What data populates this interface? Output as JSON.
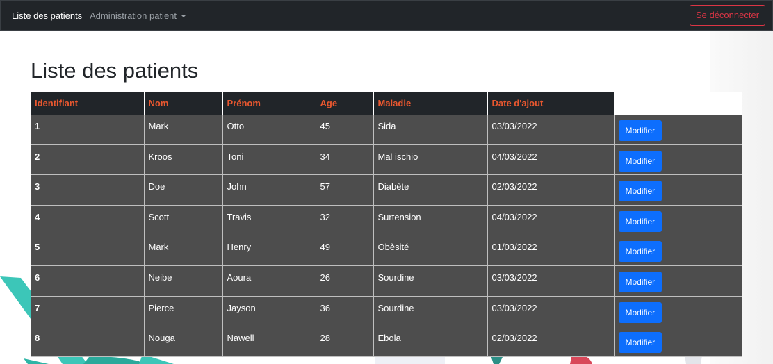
{
  "nav": {
    "brand": "Liste des patients",
    "admin_menu": "Administration patient",
    "logout": "Se déconnecter"
  },
  "page": {
    "title": "Liste des patients"
  },
  "table": {
    "headers": [
      "Identifiant",
      "Nom",
      "Prénom",
      "Age",
      "Maladie",
      "Date d'ajout"
    ],
    "rows": [
      {
        "id": "1",
        "nom": "Mark",
        "prenom": "Otto",
        "age": "45",
        "maladie": "Sida",
        "date": "03/03/2022",
        "action": "Modifier"
      },
      {
        "id": "2",
        "nom": "Kroos",
        "prenom": "Toni",
        "age": "34",
        "maladie": "Mal ischio",
        "date": "04/03/2022",
        "action": "Modifier"
      },
      {
        "id": "3",
        "nom": "Doe",
        "prenom": "John",
        "age": "57",
        "maladie": "Diabète",
        "date": "02/03/2022",
        "action": "Modifier"
      },
      {
        "id": "4",
        "nom": "Scott",
        "prenom": "Travis",
        "age": "32",
        "maladie": "Surtension",
        "date": "04/03/2022",
        "action": "Modifier"
      },
      {
        "id": "5",
        "nom": "Mark",
        "prenom": "Henry",
        "age": "49",
        "maladie": "Obèsité",
        "date": "01/03/2022",
        "action": "Modifier"
      },
      {
        "id": "6",
        "nom": "Neibe",
        "prenom": "Aoura",
        "age": "26",
        "maladie": "Sourdine",
        "date": "03/03/2022",
        "action": "Modifier"
      },
      {
        "id": "7",
        "nom": "Pierce",
        "prenom": "Jayson",
        "age": "36",
        "maladie": "Sourdine",
        "date": "03/03/2022",
        "action": "Modifier"
      },
      {
        "id": "8",
        "nom": "Nouga",
        "prenom": "Nawell",
        "age": "28",
        "maladie": "Ebola",
        "date": "02/03/2022",
        "action": "Modifier"
      }
    ]
  },
  "colors": {
    "navbar": "#212529",
    "header_text": "#e8572f",
    "row_bg": "#4d4d4d",
    "button": "#0d6efd",
    "logout": "#dc3545"
  }
}
